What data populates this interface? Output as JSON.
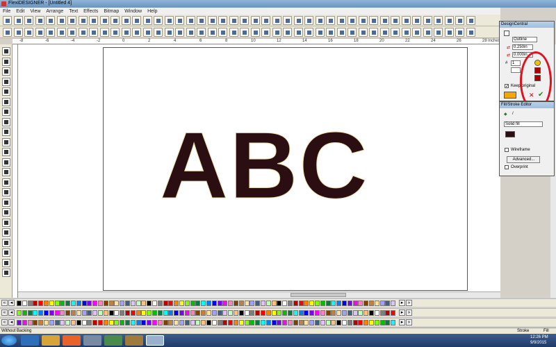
{
  "window": {
    "title": "FlexiDESIGNER - [Untitled 4]"
  },
  "menu": [
    "File",
    "Edit",
    "View",
    "Arrange",
    "Text",
    "Effects",
    "Bitmap",
    "Window",
    "Help"
  ],
  "ruler": {
    "top_labels": [
      "-8",
      "-6",
      "-4",
      "-2",
      "0",
      "2",
      "4",
      "6",
      "8",
      "10",
      "12",
      "14",
      "16",
      "18",
      "20",
      "22",
      "24",
      "26",
      "28"
    ],
    "units": "Inches"
  },
  "canvas": {
    "text": "ABC",
    "fill_color": "#2a0e12",
    "outline_color": "#e8d8a8"
  },
  "design_central": {
    "title": "DesignCentral",
    "mode": "Outline",
    "width": "0.250in",
    "offset": "0.000in",
    "count": "1",
    "keep_original_label": "Keep original",
    "keep_original_checked": true
  },
  "fill_stroke": {
    "title": "Fill/Stroke Editor",
    "fill_type": "Solid fill",
    "wireframe_label": "Wireframe",
    "advanced_label": "Advanced...",
    "overprint_label": "Overprint",
    "swatch_color": "#2a0e12"
  },
  "status": {
    "left": "Without Backing",
    "stroke_label": "Stroke",
    "fill_label": "Fill"
  },
  "clock": {
    "time": "12:26 PM",
    "date": "9/9/2015"
  }
}
